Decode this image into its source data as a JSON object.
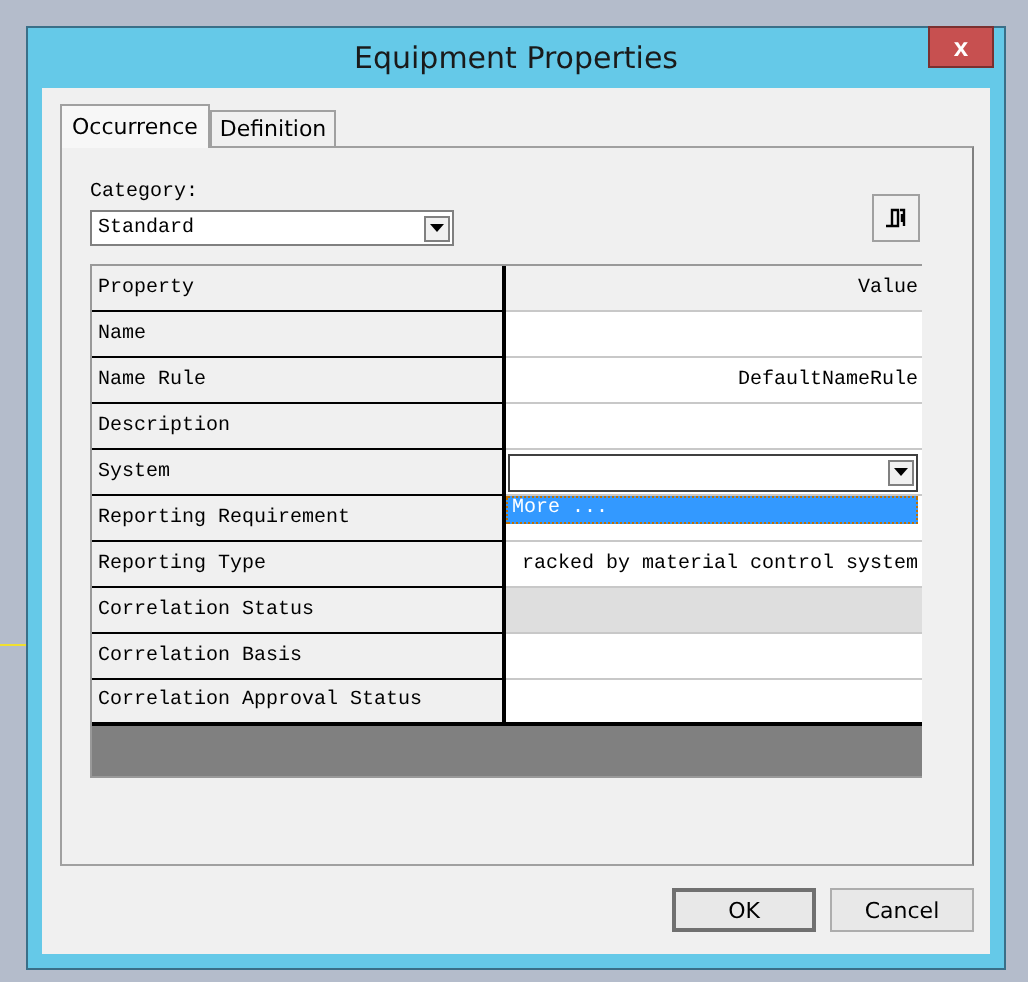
{
  "window": {
    "title": "Equipment Properties",
    "close": "x"
  },
  "tabs": [
    {
      "label": "Occurrence",
      "selected": true
    },
    {
      "label": "Definition",
      "selected": false
    }
  ],
  "category": {
    "label": "Category:",
    "value": "Standard"
  },
  "grid": {
    "columns": [
      "Property",
      "Value"
    ],
    "rows": [
      {
        "property": "Name",
        "value": "",
        "kind": "text",
        "read_only": false
      },
      {
        "property": "Name Rule",
        "value": "DefaultNameRule",
        "kind": "text",
        "read_only": false
      },
      {
        "property": "Description",
        "value": "",
        "kind": "text",
        "read_only": false
      },
      {
        "property": "System",
        "value": "",
        "kind": "combo",
        "read_only": false,
        "expanded": true,
        "options": [
          {
            "label": "More ...",
            "selected": true
          }
        ]
      },
      {
        "property": "Reporting Requirement",
        "value": "",
        "kind": "text",
        "read_only": false
      },
      {
        "property": "Reporting Type",
        "value": "racked by material control system",
        "kind": "text",
        "read_only": false
      },
      {
        "property": "Correlation Status",
        "value": "",
        "kind": "text",
        "read_only": true
      },
      {
        "property": "Correlation Basis",
        "value": "",
        "kind": "text",
        "read_only": false
      },
      {
        "property": "Correlation Approval Status",
        "value": "",
        "kind": "text",
        "read_only": false
      }
    ]
  },
  "buttons": [
    "OK",
    "Cancel"
  ]
}
